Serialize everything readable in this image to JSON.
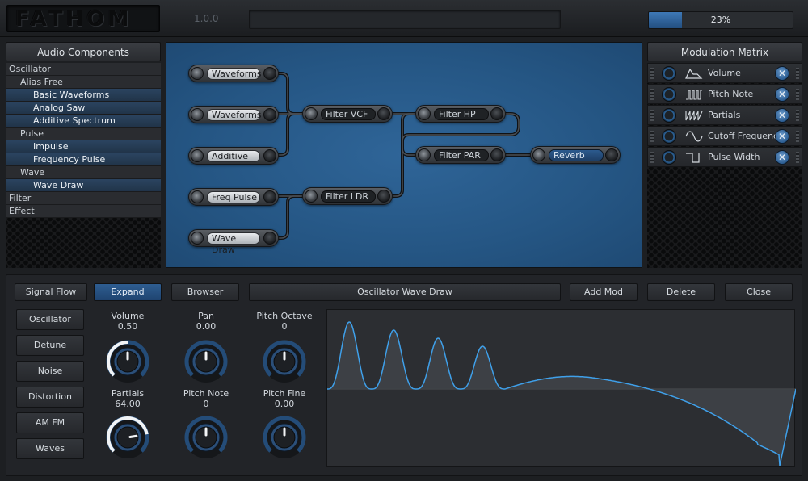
{
  "header": {
    "logo_text": "FATHOM",
    "version": "1.0.0",
    "name_value": "",
    "progress_value": 23,
    "progress_text": "23%"
  },
  "colors": {
    "accent": "#3b7dc0",
    "graph_bg": "#2a5f90",
    "panel_bg": "#222428"
  },
  "audio_components": {
    "title": "Audio Components",
    "items": [
      {
        "label": "Oscillator",
        "level": 0
      },
      {
        "label": "Alias Free",
        "level": 1
      },
      {
        "label": "Basic Waveforms",
        "level": 2
      },
      {
        "label": "Analog Saw",
        "level": 2
      },
      {
        "label": "Additive Spectrum",
        "level": 2
      },
      {
        "label": "Pulse",
        "level": 1
      },
      {
        "label": "Impulse",
        "level": 2
      },
      {
        "label": "Frequency Pulse",
        "level": 2
      },
      {
        "label": "Wave",
        "level": 1
      },
      {
        "label": "Wave Draw",
        "level": 2
      },
      {
        "label": "Filter",
        "level": 0
      },
      {
        "label": "Effect",
        "level": 0
      }
    ]
  },
  "graph": {
    "nodes": {
      "waveforms_1": "Waveforms",
      "waveforms_2": "Waveforms",
      "additive": "Additive",
      "freq_pulse": "Freq Pulse",
      "wave_draw": "Wave Draw",
      "filter_vcf": "Filter VCF",
      "filter_ldr": "Filter LDR",
      "filter_hp": "Filter HP",
      "filter_par": "Filter PAR",
      "reverb": "Reverb"
    }
  },
  "modulation_matrix": {
    "title": "Modulation Matrix",
    "rows": [
      {
        "label": "Volume",
        "icon": "envelope-icon"
      },
      {
        "label": "Pitch Note",
        "icon": "pulse-wave-icon"
      },
      {
        "label": "Partials",
        "icon": "saw-wave-icon"
      },
      {
        "label": "Cutoff Frequency",
        "icon": "sine-wave-icon"
      },
      {
        "label": "Pulse Width",
        "icon": "square-wave-icon"
      }
    ]
  },
  "editor": {
    "tabs": {
      "signal_flow": "Signal Flow",
      "expand": "Expand",
      "browser": "Browser"
    },
    "component_name": "Oscillator Wave Draw",
    "actions": {
      "add_mod": "Add Mod",
      "delete": "Delete",
      "close": "Close"
    },
    "sections": [
      "Oscillator",
      "Detune",
      "Noise",
      "Distortion",
      "AM FM",
      "Waves"
    ],
    "params": [
      {
        "title": "Volume",
        "value": "0.50",
        "level": 0.5
      },
      {
        "title": "Pan",
        "value": "0.00",
        "level": 0
      },
      {
        "title": "Pitch Octave",
        "value": "0",
        "level": 0
      },
      {
        "title": "Partials",
        "value": "64.00",
        "level": 0.8
      },
      {
        "title": "Pitch Note",
        "value": "0",
        "level": 0
      },
      {
        "title": "Pitch Fine",
        "value": "0.00",
        "level": 0
      }
    ]
  }
}
